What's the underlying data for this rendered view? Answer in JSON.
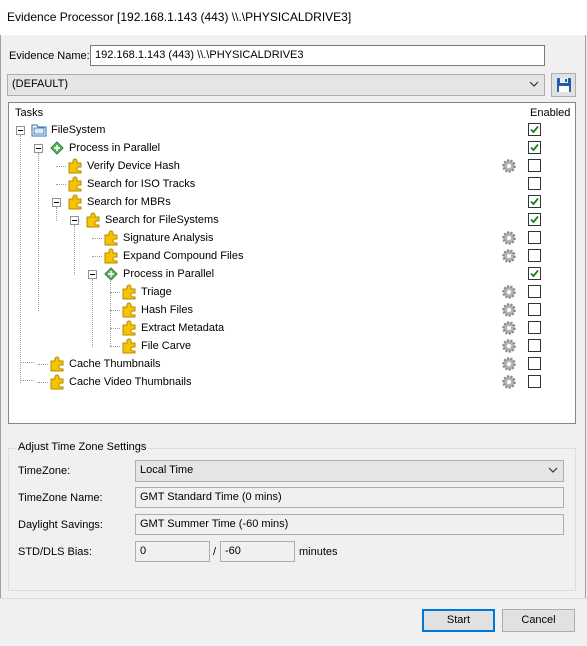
{
  "window": {
    "title": "Evidence Processor [192.168.1.143 (443) \\\\.\\PHYSICALDRIVE3]"
  },
  "evidence": {
    "label": "Evidence Name:",
    "value": "192.168.1.143 (443) \\\\.\\PHYSICALDRIVE3"
  },
  "profile": {
    "selected": "(DEFAULT)"
  },
  "tree": {
    "col_tasks": "Tasks",
    "col_enabled": "Enabled",
    "rows": [
      {
        "label": "FileSystem",
        "icon": "folder-icon",
        "checked": true,
        "gear": false
      },
      {
        "label": "Process in Parallel",
        "icon": "parallel-icon",
        "checked": true,
        "gear": false
      },
      {
        "label": "Verify Device Hash",
        "icon": "puzzle-icon",
        "checked": false,
        "gear": true
      },
      {
        "label": "Search for ISO Tracks",
        "icon": "puzzle-icon",
        "checked": false,
        "gear": false
      },
      {
        "label": "Search for MBRs",
        "icon": "puzzle-icon",
        "checked": true,
        "gear": false
      },
      {
        "label": "Search for FileSystems",
        "icon": "puzzle-icon",
        "checked": true,
        "gear": false
      },
      {
        "label": "Signature Analysis",
        "icon": "puzzle-icon",
        "checked": false,
        "gear": true
      },
      {
        "label": "Expand Compound Files",
        "icon": "puzzle-icon",
        "checked": false,
        "gear": true
      },
      {
        "label": "Process in Parallel",
        "icon": "parallel-icon",
        "checked": true,
        "gear": false
      },
      {
        "label": "Triage",
        "icon": "puzzle-icon",
        "checked": false,
        "gear": true
      },
      {
        "label": "Hash Files",
        "icon": "puzzle-icon",
        "checked": false,
        "gear": true
      },
      {
        "label": "Extract Metadata",
        "icon": "puzzle-icon",
        "checked": false,
        "gear": true
      },
      {
        "label": "File Carve",
        "icon": "puzzle-icon",
        "checked": false,
        "gear": true
      },
      {
        "label": "Cache Thumbnails",
        "icon": "puzzle-icon",
        "checked": false,
        "gear": true
      },
      {
        "label": "Cache Video Thumbnails",
        "icon": "puzzle-icon",
        "checked": false,
        "gear": true
      }
    ]
  },
  "timezone": {
    "group_title": "Adjust Time Zone Settings",
    "tz_label": "TimeZone:",
    "tz_value": "Local Time",
    "name_label": "TimeZone Name:",
    "name_value": "GMT Standard Time (0 mins)",
    "dst_label": "Daylight Savings:",
    "dst_value": "GMT Summer Time (-60 mins)",
    "bias_label": "STD/DLS Bias:",
    "bias_std": "0",
    "bias_sep": "/",
    "bias_dls": "-60",
    "bias_unit": "minutes"
  },
  "buttons": {
    "start": "Start",
    "cancel": "Cancel"
  },
  "colors": {
    "accent": "#0078d7",
    "check": "#1a7f1a",
    "save_icon": "#1e5fa8"
  }
}
